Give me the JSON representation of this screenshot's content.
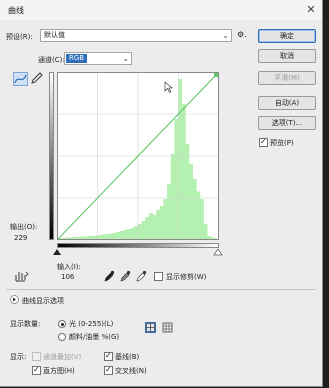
{
  "window": {
    "title": "曲线",
    "close_glyph": "✕"
  },
  "preset": {
    "label": "预设(R):",
    "value": "默认值",
    "menu_glyph": "⚙."
  },
  "channel": {
    "label": "通道(C):",
    "value": "RGB"
  },
  "buttons": {
    "ok": "确定",
    "cancel": "取消",
    "smooth": "平滑(M)",
    "auto": "自动(A)",
    "options": "选项(T)...",
    "preview": "预览(P)"
  },
  "graph": {
    "output_label": "输出(O):",
    "output_value": "229",
    "input_label": "输入(I):",
    "input_value": "106",
    "show_clipping_label": "显示修剪(W)",
    "histogram": [
      2,
      2,
      3,
      3,
      4,
      4,
      5,
      5,
      6,
      6,
      7,
      8,
      9,
      10,
      11,
      12,
      14,
      16,
      18,
      20,
      22,
      26,
      30,
      36,
      44,
      52,
      48,
      58,
      66,
      80,
      110,
      170,
      240,
      320,
      270,
      190,
      150,
      120,
      95,
      80,
      30,
      6,
      3,
      1
    ]
  },
  "display_options": {
    "section_label": "曲线显示选项",
    "amount_label": "显示数量:",
    "light_label": "光 (0-255)(L)",
    "pigment_label": "颜料/油墨 %(G)",
    "show_label": "显示:",
    "channel_overlay_label": "通道叠加(V)",
    "baseline_label": "基线(B)",
    "histogram_label": "直方图(H)",
    "intersection_label": "交叉线(N)"
  },
  "colors": {
    "accent": "#2f6fb8",
    "curve": "#5fc96a",
    "histogram": "#b4f0b0"
  }
}
